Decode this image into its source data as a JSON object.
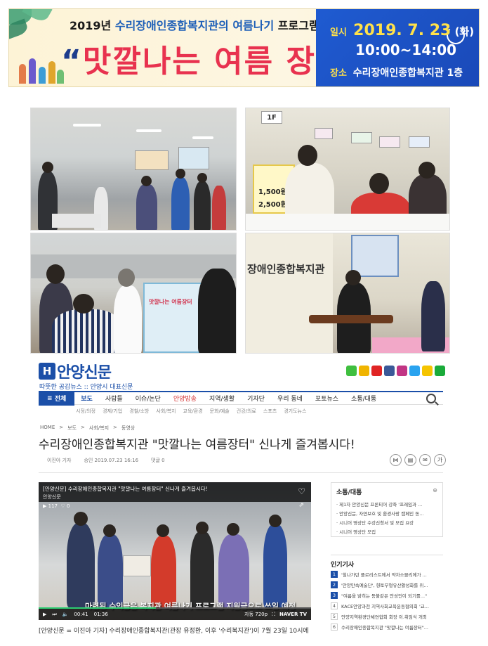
{
  "banner": {
    "top_prefix": "2019년",
    "top_highlight": "수리장애인종합복지관의 여름나기",
    "top_suffix": "프로그램 지원을 위한",
    "title": "맛깔나는 여름 장터",
    "date_label": "일시",
    "date_value": "2019. 7. 23",
    "date_day": "(화)",
    "time": "10:00~14:00",
    "place_label": "장소",
    "place_value": "수리장애인종합복지관 1층"
  },
  "photos": {
    "floor_sign": "1F",
    "price1": "1,500원",
    "price2": "2,500원",
    "poster_title": "맛깔나는 여름장터",
    "wall_name": "장애인종합복지관"
  },
  "site": {
    "logo_mark": "H",
    "logo_text": "안양신문",
    "logo_sub": "따뜻한 공감뉴스 :: 안양시 대표신문",
    "social_colors": [
      "#3fbf3f",
      "#f0b400",
      "#e02424",
      "#3b5998",
      "#c13584",
      "#2aa3ef",
      "#f5c400",
      "#1aab3a"
    ]
  },
  "nav": {
    "all": "전체",
    "items": [
      "보도",
      "사람들",
      "이슈/논단",
      "안양방송",
      "지역/생활",
      "기자단",
      "우리 동네",
      "포토뉴스",
      "소통/대통"
    ],
    "subitems": [
      "시정/의정",
      "경제/기업",
      "경찰/소방",
      "사회/복지",
      "교육/환경",
      "문화/예술",
      "건강/의료",
      "스포츠",
      "경기도뉴스"
    ]
  },
  "breadcrumb": [
    "HOME",
    ">",
    "보도",
    ">",
    "사회/복지",
    ">",
    "동영상"
  ],
  "article": {
    "title": "수리장애인종합복지관 \"맛깔나는 여름장터\" 신나게 즐겨봅시다!",
    "author": "이진아 기자",
    "date": "승인 2019.07.23 16:16",
    "comments": "댓글 0",
    "body_start": "[안양신문 = 이진아 기자] 수리장애인종합복지관(관장 유정환, 이후 '수리복지관')이 7월 23일 10시에"
  },
  "video": {
    "title": "[안양신문] 수리장애인종합복지관 \"맛깔나는 여름장터\" 신나게 즐겨봅시다!",
    "channel": "안양신문",
    "views": "117",
    "likes": "0",
    "caption": "마련된 수익금은 복지관 여름나기 프로그램 지원금으로 쓰일 예정",
    "time_current": "00:41",
    "time_total": "01:36",
    "quality": "자동 720p",
    "brand": "NAVER TV",
    "progress": 0.43
  },
  "sidebar": {
    "box_title": "소통/대통",
    "box_items": [
      "제1차 안양신문 프론티어 강좌 '프레임과 ...",
      "안양신문, 자연보호 및 환경사랑 캠페인 동...",
      "시니어 영상단 수강신청서 및 모집 요강",
      "시니어 영상단 모집"
    ],
    "popular_title": "인기기사",
    "popular": [
      {
        "num": "1",
        "text": "'힐나가던 플로리스트에서 약차소믈리에가 ..."
      },
      {
        "num": "2",
        "text": "'안양만속예술단', 향토무형유산활성화를 위..."
      },
      {
        "num": "3",
        "text": "\"여름을 밝히는 등불같은 안성인이 되기를...\""
      },
      {
        "num": "4",
        "text": "KACE안양과천 지역사회교육운동협의회 '교..."
      },
      {
        "num": "5",
        "text": "안양지역환경단체연합회 회장 이.취임식 개최"
      },
      {
        "num": "6",
        "text": "수리장애인종합복지관 \"맛깔나는 여름장터\"..."
      }
    ]
  }
}
